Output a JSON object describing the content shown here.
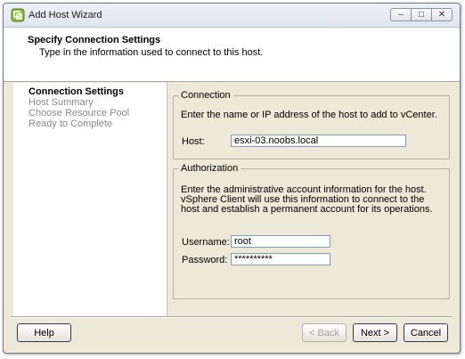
{
  "window": {
    "title": "Add Host Wizard",
    "controls": {
      "minimize": "–",
      "restore": "□",
      "close": "✕"
    }
  },
  "header": {
    "title": "Specify Connection Settings",
    "subtitle": "Type in the information used to connect to this host."
  },
  "steps": [
    {
      "label": "Connection Settings",
      "active": true
    },
    {
      "label": "Host Summary",
      "active": false
    },
    {
      "label": "Choose Resource Pool",
      "active": false
    },
    {
      "label": "Ready to Complete",
      "active": false
    }
  ],
  "connection": {
    "group_label": "Connection",
    "description": "Enter the name or IP address of the host to add to vCenter.",
    "host_label": "Host:",
    "host_value": "esxi-03.noobs.local"
  },
  "authorization": {
    "group_label": "Authorization",
    "description": "Enter the administrative account information for the host. vSphere Client will use this information to connect to the host and establish a permanent account for its operations.",
    "username_label": "Username:",
    "username_value": "root",
    "password_label": "Password:",
    "password_value": "**********"
  },
  "footer": {
    "help": "Help",
    "back": "< Back",
    "next": "Next >",
    "cancel": "Cancel"
  }
}
